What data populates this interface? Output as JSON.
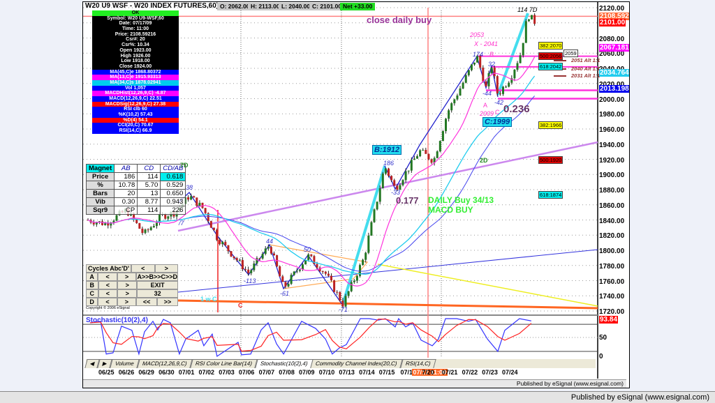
{
  "header": {
    "title": "W20 U9 WSF - W20 INDEX FUTURES,60) 500",
    "open": "O: 2062.00",
    "high": "H: 2113.00",
    "low": "L: 2040.00",
    "close": "C: 2101.00",
    "net": "Net +33.00"
  },
  "data_window": {
    "ok": "OK",
    "rows": [
      {
        "t": "Symbol: W20 U9-WSF,60",
        "c": "#000000"
      },
      {
        "t": "Date: 07/17/09",
        "c": "#000000"
      },
      {
        "t": "Time: 11:00",
        "c": "#000000"
      },
      {
        "t": "Price: 2108.59216",
        "c": "#000000"
      },
      {
        "t": "Csr#: 20",
        "c": "#000000"
      },
      {
        "t": "Csr%: 10.34",
        "c": "#000000"
      },
      {
        "t": "Open 1923.00",
        "c": "#000000"
      },
      {
        "t": "High 1926.00",
        "c": "#000000"
      },
      {
        "t": "Low 1918.00",
        "c": "#000000"
      },
      {
        "t": "Close 1924.00",
        "c": "#000000"
      },
      {
        "t": "MA(45,C)e 1868.80372",
        "c": "#0000ff"
      },
      {
        "t": "MA(13,C)e 1915.93313",
        "c": "#ff00ff"
      },
      {
        "t": "MA(34,C)s 1878.02941",
        "c": "#00ccee"
      },
      {
        "t": "Vol 1,057",
        "c": "#0000ff"
      },
      {
        "t": "MACDHist(12,26,9,C) -4.87",
        "c": "#ff00ff"
      },
      {
        "t": "MACD(12,26,9,C) 22.51",
        "c": "#0000ff"
      },
      {
        "t": "MACDSig(12,26,9,C) 27.38",
        "c": "#ff0000"
      },
      {
        "t": "RSI clb 60",
        "c": "#0000ff"
      },
      {
        "t": "%K(10,2) 57.43",
        "c": "#0000ff"
      },
      {
        "t": "%D(4) 54.1",
        "c": "#ff0000"
      },
      {
        "t": "CCI(20,C) 70.67",
        "c": "#0000ff"
      },
      {
        "t": "RSI(14,C) 66.9",
        "c": "#0000ff"
      }
    ]
  },
  "magnet": {
    "headers": [
      "Magnet",
      "AB",
      "CD",
      "CD/AB"
    ],
    "rows": [
      [
        "Price",
        "186",
        "114",
        "0.618"
      ],
      [
        "%",
        "10.78",
        "5.70",
        "0.529"
      ],
      [
        "Bars",
        "20",
        "13",
        "0.650"
      ],
      [
        "Vib",
        "0.30",
        "8.77",
        "0.943"
      ],
      [
        "Sqr9",
        "CP",
        "114",
        "226"
      ]
    ]
  },
  "cycles": {
    "title": "Cycles Abc'D'",
    "prev": "<",
    "next": ">",
    "rows": [
      "A",
      "B",
      "C",
      "D"
    ],
    "seq": "A>>B>>C>>D",
    "exit": "EXIT",
    "count": "32",
    "rew": "<<",
    "ff": ">>",
    "copyright": "Copyright © 2006 eSignal"
  },
  "price_axis": {
    "ticks": [
      "2120.00",
      "2100.00",
      "2080.00",
      "2060.00",
      "2040.00",
      "2020.00",
      "2000.00",
      "1980.00",
      "1960.00",
      "1940.00",
      "1920.00",
      "1900.00",
      "1880.00",
      "1860.00",
      "1840.00",
      "1820.00",
      "1800.00",
      "1780.00",
      "1760.00",
      "1740.00",
      "1720.00"
    ],
    "markers": [
      {
        "v": "2108.59216",
        "c": "#ff6633"
      },
      {
        "v": "2101.00",
        "c": "#ff0000"
      },
      {
        "v": "2067.18109",
        "c": "#ff00ff"
      },
      {
        "v": "2034.76471",
        "c": "#22ccee"
      },
      {
        "v": "2013.19839",
        "c": "#0000ee"
      }
    ]
  },
  "fib_boxes": [
    {
      "t": "382:2070",
      "c": "#ffff00"
    },
    {
      "t": "500:2056",
      "c": "#dd0000"
    },
    {
      "t": "2059",
      "c": "#ffffff"
    },
    {
      "t": "618:2042",
      "c": "#00eeee"
    },
    {
      "t": "382:1966",
      "c": "#ffff00"
    },
    {
      "t": "500:1920",
      "c": "#dd0000"
    },
    {
      "t": "618:1874",
      "c": "#00eeee"
    }
  ],
  "alt_labels": [
    "2051 Alt 1:1",
    "2040 Alt 1:1",
    "2031 Alt 1:1"
  ],
  "annotations": {
    "close_daily_buy": "close daily buy",
    "top": "114 7D",
    "x2053": "2053",
    "x2041": "X - 2041",
    "p174": "174",
    "B": "B",
    "p32": "32",
    "m44": "-44",
    "m42": "-42",
    "A": "A",
    "C": "C",
    "r236": "0.236",
    "p2009": "2009",
    "c1999": "C:1999",
    "d7": "7D",
    "d2": "2D",
    "b1912": "B:1912",
    "p186": "186",
    "m33": "-33",
    "r177": "0.177",
    "daily": "DAILY Buy 34/13",
    "macd": "MACD BUY",
    "p38": "38",
    "m113": "-113",
    "p44": "44",
    "m61": "-61",
    "p50": "50",
    "m71": "-71",
    "wc": "1 w C",
    "cred": "C",
    "s7": "/7"
  },
  "stochastic": {
    "title": "Stochastic(10(2),4)",
    "value": "93.84",
    "ticks": [
      "50",
      "0"
    ],
    "k": [
      [
        -0.84,
        89
      ],
      [
        -0.31,
        93
      ],
      [
        -0.03,
        6
      ],
      [
        0.31,
        9
      ],
      [
        0.73,
        80
      ],
      [
        1.25,
        69
      ],
      [
        1.6,
        6
      ],
      [
        1.88,
        65
      ],
      [
        2.3,
        93
      ],
      [
        2.54,
        70
      ],
      [
        2.82,
        98
      ],
      [
        3.17,
        89
      ],
      [
        3.62,
        6
      ],
      [
        3.94,
        46
      ],
      [
        4.56,
        69
      ],
      [
        4.84,
        28
      ],
      [
        5.26,
        59
      ],
      [
        5.5,
        0
      ],
      [
        6.55,
        37
      ],
      [
        6.72,
        4
      ],
      [
        7.18,
        6
      ],
      [
        7.7,
        70
      ],
      [
        8.05,
        89
      ],
      [
        8.47,
        33
      ],
      [
        8.82,
        6
      ],
      [
        9.72,
        93
      ],
      [
        10.42,
        74
      ],
      [
        10.91,
        46
      ],
      [
        11.25,
        6
      ],
      [
        11.6,
        22
      ],
      [
        11.95,
        31
      ],
      [
        12.65,
        100
      ],
      [
        13.1,
        100
      ],
      [
        13.55,
        96
      ],
      [
        13.9,
        100
      ],
      [
        14.39,
        78
      ],
      [
        14.56,
        100
      ],
      [
        14.91,
        78
      ],
      [
        15.26,
        89
      ],
      [
        15.68,
        43
      ],
      [
        16.24,
        28
      ],
      [
        16.55,
        46
      ],
      [
        16.9,
        100
      ],
      [
        17.46,
        100
      ],
      [
        18.05,
        93
      ],
      [
        18.4,
        98
      ],
      [
        18.99,
        46
      ],
      [
        19.51,
        13
      ],
      [
        19.86,
        69
      ],
      [
        20.59,
        100
      ],
      [
        21.18,
        94
      ]
    ]
  },
  "price_path": [
    [
      -0.94,
      1840
    ],
    [
      -0.07,
      1835
    ],
    [
      0.98,
      1853
    ],
    [
      1.85,
      1821
    ],
    [
      2.72,
      1845
    ],
    [
      3.41,
      1850
    ],
    [
      4.11,
      1872
    ],
    [
      4.81,
      1855
    ],
    [
      5.5,
      1817
    ],
    [
      7.07,
      1770
    ],
    [
      8.12,
      1807
    ],
    [
      8.82,
      1750
    ],
    [
      10.03,
      1793
    ],
    [
      10.9,
      1770
    ],
    [
      11.78,
      1729
    ],
    [
      12.82,
      1789
    ],
    [
      13.87,
      1911
    ],
    [
      14.39,
      1881
    ],
    [
      15.61,
      1931
    ],
    [
      16.31,
      1918
    ],
    [
      17.0,
      1982
    ],
    [
      18.47,
      2056
    ],
    [
      18.92,
      2014
    ],
    [
      19.2,
      2044
    ],
    [
      19.51,
      2005
    ],
    [
      20.14,
      2028
    ],
    [
      20.66,
      2060
    ],
    [
      21.0,
      2111
    ],
    [
      21.36,
      2101
    ]
  ],
  "tabs": [
    "Volume",
    "MACD(12,26,9,C)",
    "RSI Color Line Bar(14)",
    "Stochastic(10(2),4)",
    "Commodity Channel Index(20,C)",
    "RSI(14,C)"
  ],
  "dates": [
    "06/25",
    "06/26",
    "06/29",
    "06/30",
    "07/01",
    "07/02",
    "07/03",
    "07/06",
    "07/07",
    "07/08",
    "07/09",
    "07/10",
    "07/13",
    "07/14",
    "07/15",
    "07/1",
    "07/17 11:00",
    "7/20",
    "07/21",
    "07/22",
    "07/23",
    "07/24"
  ],
  "published": "Published by eSignal (www.esignal.com)",
  "status": "Published by eSignal (www.esignal.com)"
}
